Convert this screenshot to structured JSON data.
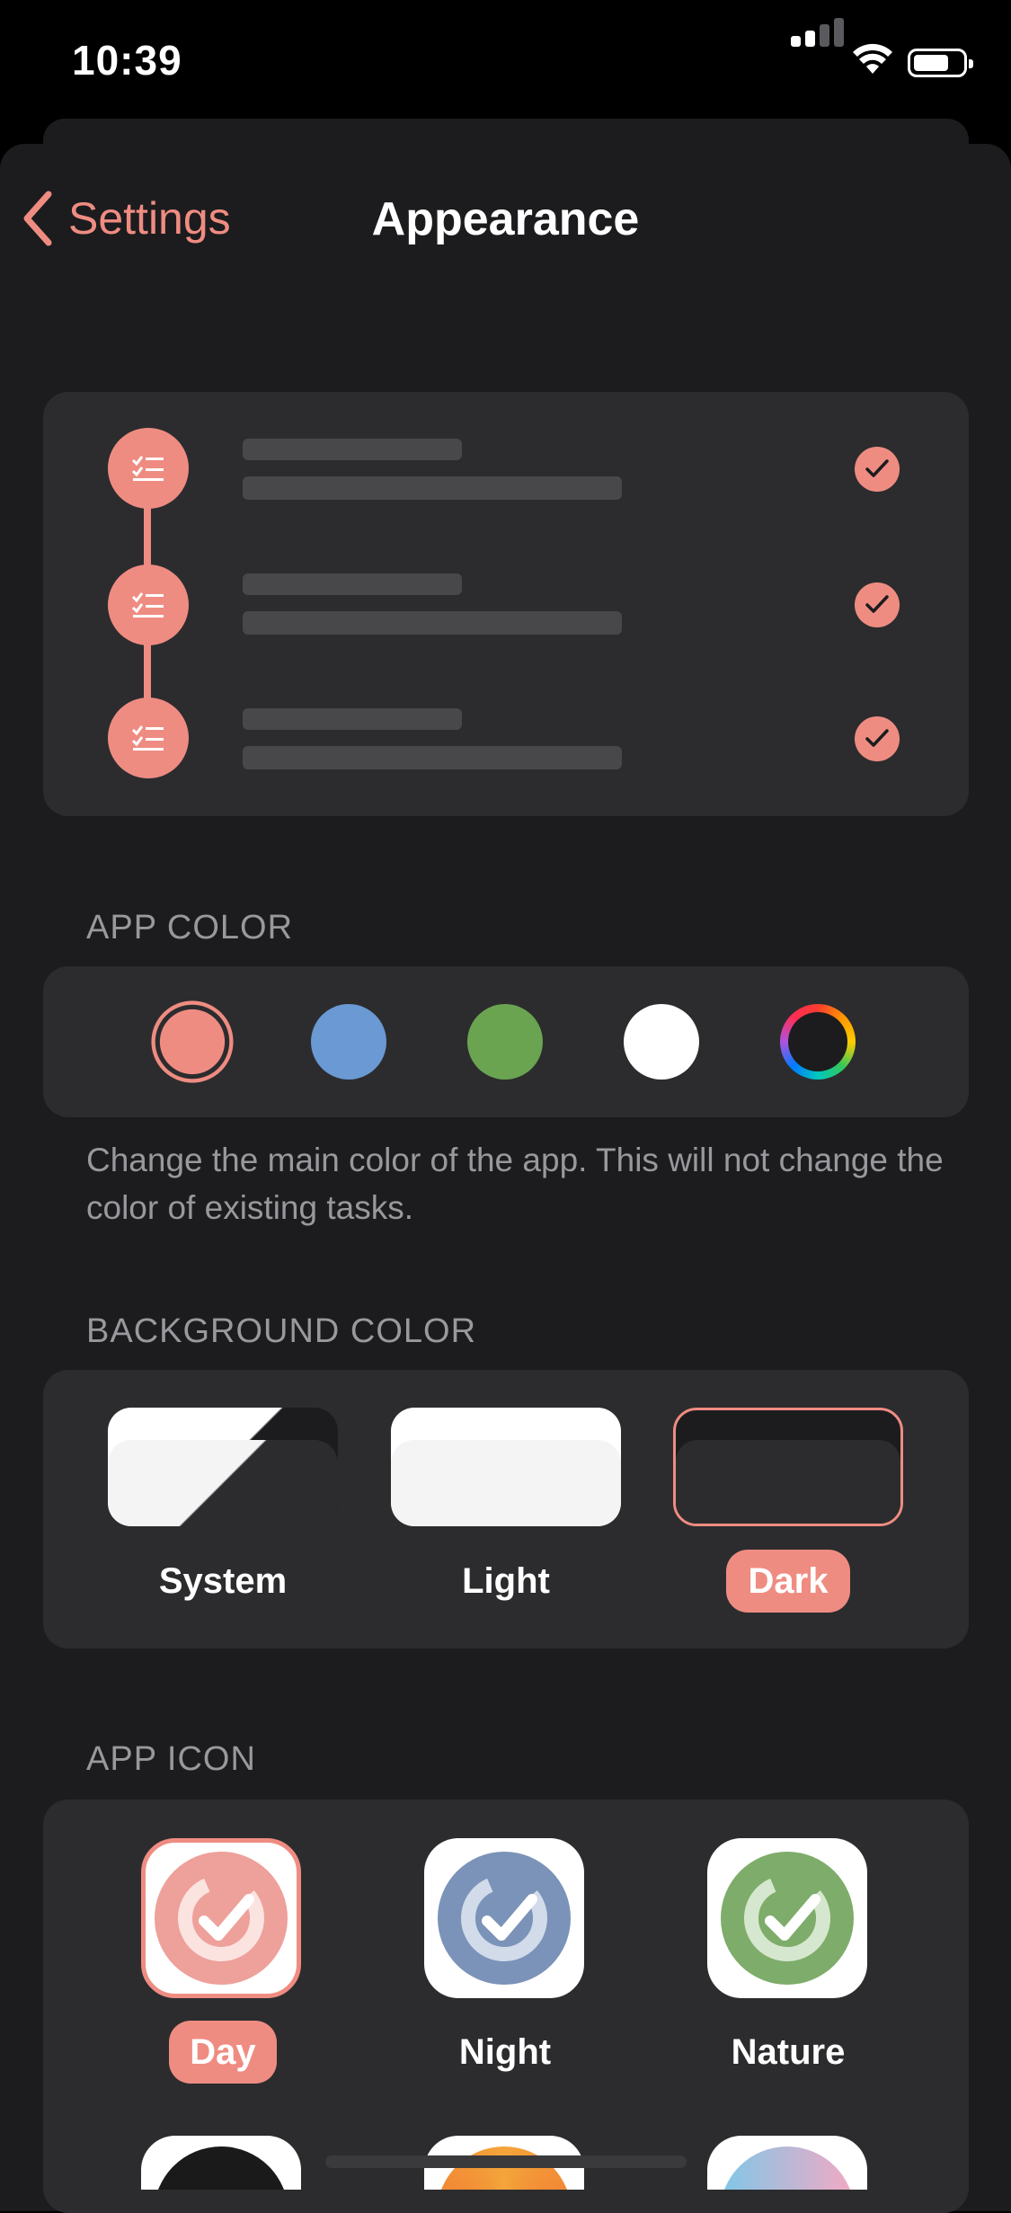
{
  "status_bar": {
    "time": "10:39"
  },
  "nav": {
    "back_label": "Settings",
    "title": "Appearance"
  },
  "preview": {
    "rows": 3
  },
  "app_color": {
    "header": "APP COLOR",
    "swatches": [
      {
        "name": "coral",
        "color": "#ef8c82",
        "selected": true
      },
      {
        "name": "blue",
        "color": "#6a99d3"
      },
      {
        "name": "green",
        "color": "#6aa451"
      },
      {
        "name": "white",
        "color": "#ffffff"
      },
      {
        "name": "custom",
        "color": "rainbow"
      }
    ],
    "footer": "Change the main color of the app. This will not change the color of existing tasks."
  },
  "background_color": {
    "header": "BACKGROUND COLOR",
    "options": [
      {
        "label": "System"
      },
      {
        "label": "Light"
      },
      {
        "label": "Dark",
        "selected": true
      }
    ]
  },
  "app_icon": {
    "header": "APP ICON",
    "options": [
      {
        "label": "Day",
        "color": "#eea09a",
        "selected": true
      },
      {
        "label": "Night",
        "color": "#7b93b8"
      },
      {
        "label": "Nature",
        "color": "#7eac6a"
      }
    ]
  },
  "colors": {
    "accent": "#ef8c82",
    "background": "#1c1c1e",
    "card": "#2c2c2e",
    "secondary_text": "#98989d"
  }
}
